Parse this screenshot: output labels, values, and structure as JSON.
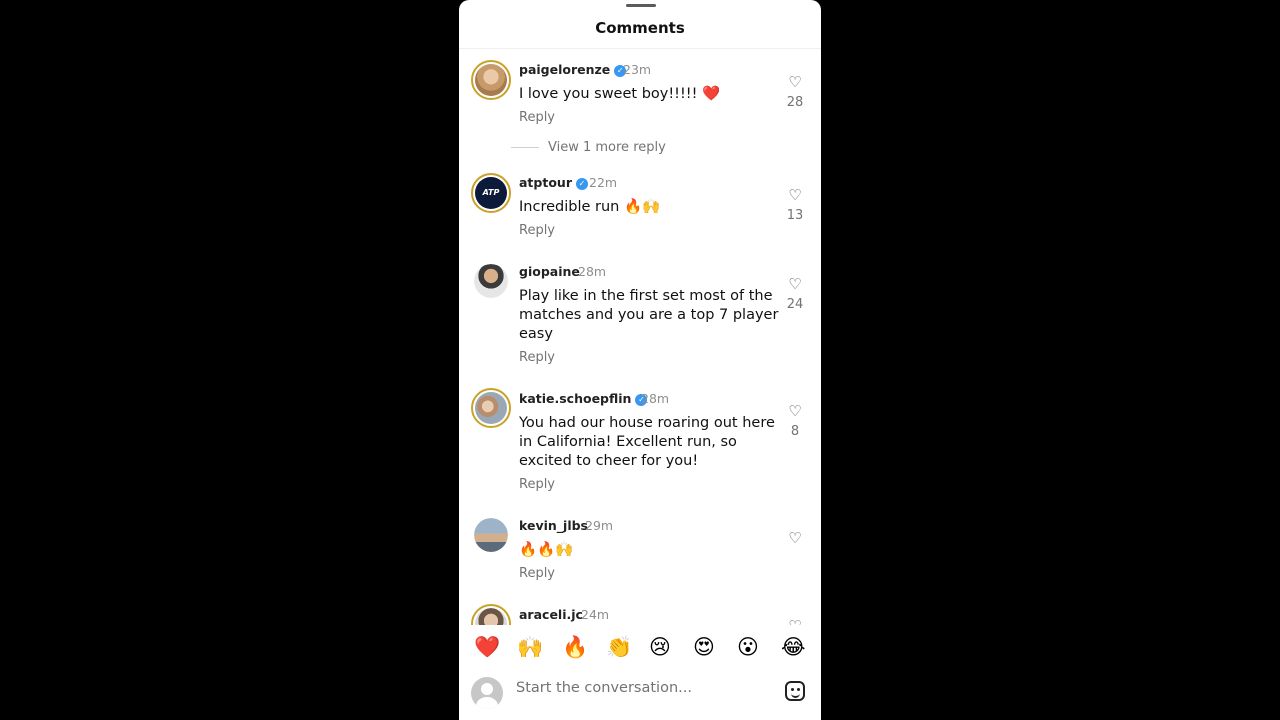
{
  "header": {
    "title": "Comments"
  },
  "comments": [
    {
      "username": "paigelorenze",
      "verified": true,
      "time": "23m",
      "text": "I love you sweet boy!!!!! ❤️",
      "reply": "Reply",
      "likes": "28",
      "view_more": "View 1 more reply"
    },
    {
      "username": "atptour",
      "verified": true,
      "time": "22m",
      "text": "Incredible run 🔥🙌",
      "reply": "Reply",
      "likes": "13"
    },
    {
      "username": "giopaine",
      "verified": false,
      "time": "28m",
      "text": "Play like in the first set most of the matches and you are a top 7 player easy",
      "reply": "Reply",
      "likes": "24"
    },
    {
      "username": "katie.schoepflin",
      "verified": true,
      "time": "28m",
      "text": "You had our house roaring out here in California! Excellent run, so excited to cheer for you!",
      "reply": "Reply",
      "likes": "8"
    },
    {
      "username": "kevin_jlbs",
      "verified": false,
      "time": "29m",
      "text": "🔥🔥🙌",
      "reply": "Reply",
      "likes": ""
    },
    {
      "username": "araceli.jc",
      "verified": false,
      "time": "24m",
      "text": "",
      "reply": "",
      "likes": ""
    }
  ],
  "emoji_bar": [
    "❤️",
    "🙌",
    "🔥",
    "👏",
    "😢",
    "😍",
    "😮",
    "😂"
  ],
  "input": {
    "placeholder": "Start the conversation..."
  },
  "icons": {
    "heart": "heart-outline-icon",
    "verified": "verified-badge-icon",
    "sticker": "sticker-icon"
  },
  "colors": {
    "verified": "#3897f0",
    "story_ring": "#c9a227",
    "muted": "#737373"
  }
}
